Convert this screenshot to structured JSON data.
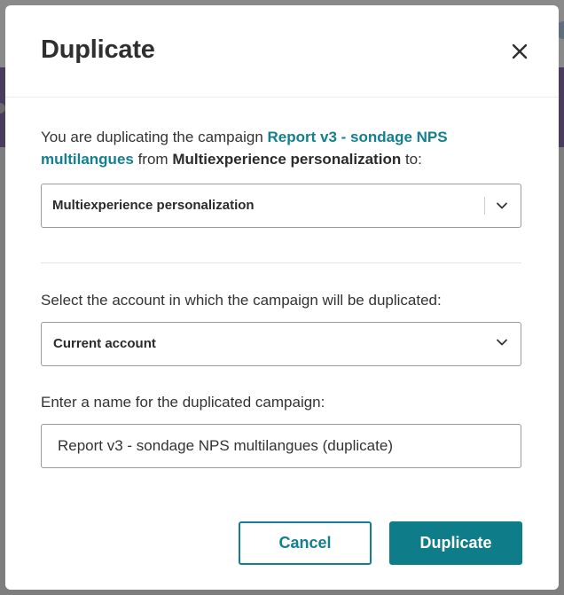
{
  "dialog": {
    "title": "Duplicate",
    "close_icon": "close-icon"
  },
  "intro": {
    "prefix": "You are duplicating the campaign ",
    "campaign_name": "Report v3 - sondage NPS multilangues",
    "middle": " from ",
    "source_name": "Multiexperience personalization",
    "suffix": " to:"
  },
  "destination_select": {
    "value": "Multiexperience personalization",
    "icon": "chevron-down-icon"
  },
  "account": {
    "label": "Select the account in which the campaign will be duplicated:",
    "value": "Current account",
    "icon": "chevron-down-icon"
  },
  "name_field": {
    "label": "Enter a name for the duplicated campaign:",
    "value": "Report v3 - sondage NPS multilangues (duplicate)"
  },
  "buttons": {
    "cancel": "Cancel",
    "duplicate": "Duplicate"
  },
  "colors": {
    "accent": "#0f7d89",
    "link": "#14808e",
    "overlay": "#8a8a8a"
  }
}
